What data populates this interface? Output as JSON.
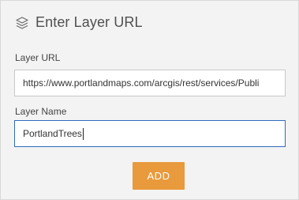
{
  "header": {
    "icon": "layers-icon",
    "title": "Enter Layer URL"
  },
  "form": {
    "url_label": "Layer URL",
    "url_value": "https://www.portlandmaps.com/arcgis/rest/services/Publi",
    "name_label": "Layer Name",
    "name_value": "PortlandTrees"
  },
  "actions": {
    "add_label": "ADD"
  },
  "colors": {
    "accent": "#e89a3c",
    "focus_border": "#2f6dbb",
    "background": "#f3f3f3"
  }
}
